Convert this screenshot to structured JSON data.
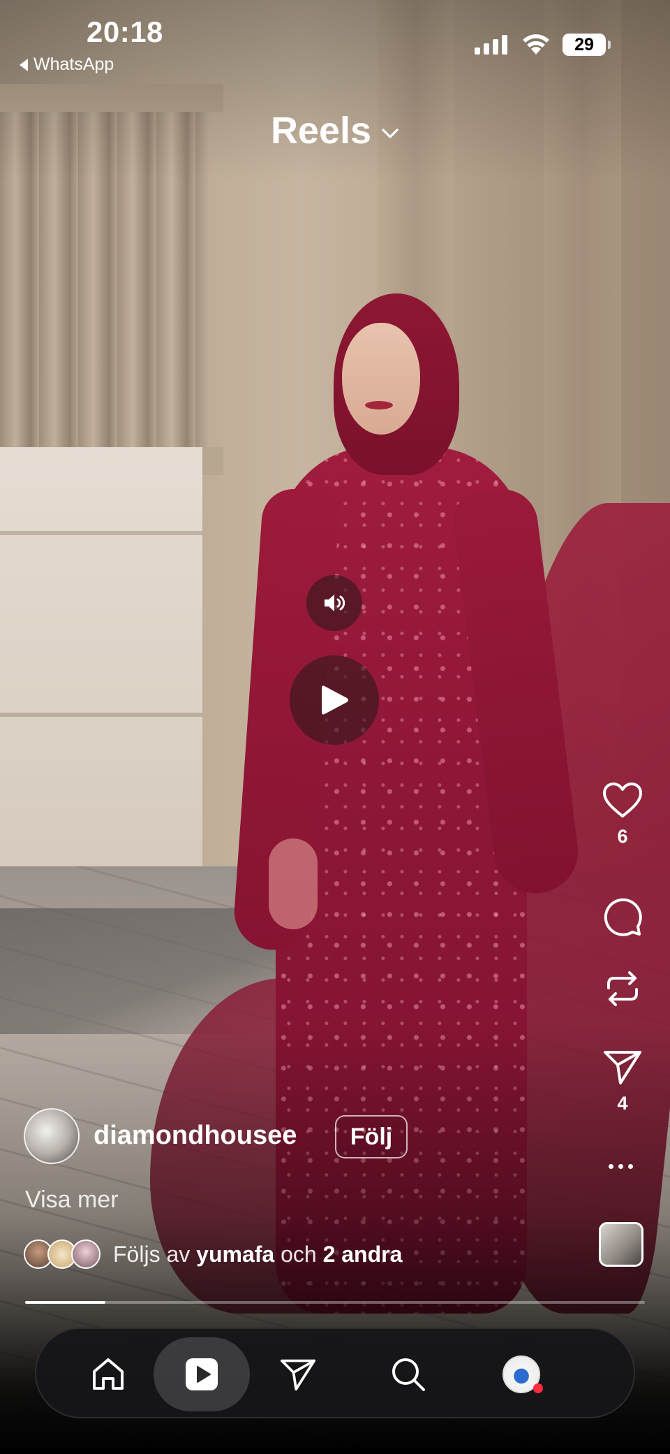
{
  "status_bar": {
    "time": "20:18",
    "back_app": "WhatsApp",
    "battery": "29",
    "signal_bars": 4,
    "wifi": true
  },
  "header": {
    "title": "Reels",
    "dropdown_icon": "chevron-down-icon"
  },
  "player": {
    "mute_icon": "speaker-icon",
    "play_icon": "play-icon"
  },
  "actions": {
    "like_icon": "heart-icon",
    "like_count": "6",
    "comment_icon": "comment-bubble-icon",
    "repost_icon": "repost-icon",
    "share_icon": "send-icon",
    "share_count": "4",
    "more_icon": "more-dots-icon"
  },
  "post": {
    "username": "diamondhousee",
    "follow_label": "Följ",
    "caption_more": "Visa mer",
    "followed_by_prefix": "Följs av",
    "followed_by_user": "yumafa",
    "followed_by_joiner": "och",
    "followed_by_others": "2 andra",
    "progress": 0.13
  },
  "tabbar": {
    "items": [
      {
        "name": "home",
        "icon": "home-icon"
      },
      {
        "name": "reels",
        "icon": "reels-icon",
        "active": true
      },
      {
        "name": "messages",
        "icon": "send-icon"
      },
      {
        "name": "search",
        "icon": "search-icon"
      },
      {
        "name": "profile",
        "icon": "profile-avatar",
        "notification": true
      }
    ]
  },
  "colors": {
    "accent": "#ff2d3d",
    "gown": "#8e1636"
  }
}
